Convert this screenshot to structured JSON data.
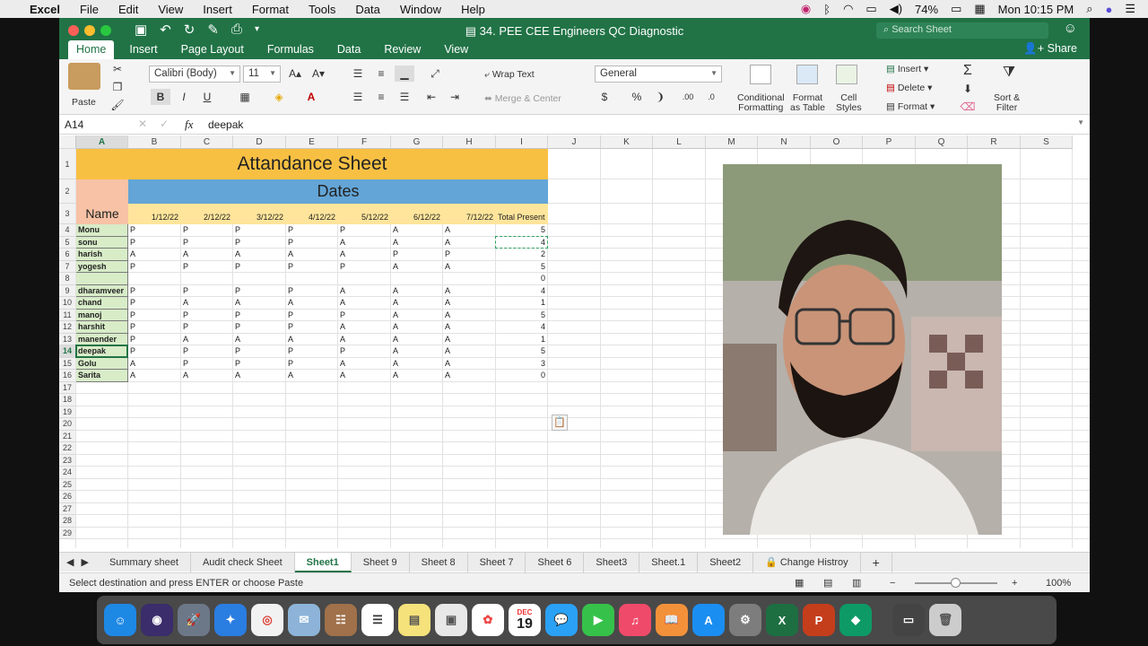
{
  "menubar": {
    "apple": "",
    "app_name": "Excel",
    "items": [
      "File",
      "Edit",
      "View",
      "Insert",
      "Format",
      "Tools",
      "Data",
      "Window",
      "Help"
    ],
    "battery": "74%",
    "clock": "Mon 10:15 PM"
  },
  "window": {
    "title": "34. PEE CEE Engineers QC Diagnostic",
    "search_placeholder": "Search Sheet",
    "share_label": "Share",
    "tabs": [
      "Home",
      "Insert",
      "Page Layout",
      "Formulas",
      "Data",
      "Review",
      "View"
    ],
    "active_tab": "Home"
  },
  "ribbon": {
    "paste": "Paste",
    "font_name": "Calibri (Body)",
    "font_size": "11",
    "bold": "B",
    "italic": "I",
    "underline": "U",
    "wrap_text": "Wrap Text",
    "merge_center": "Merge & Center",
    "number_format": "General",
    "currency": "$",
    "percent": "%",
    "comma": "❩",
    "conditional_formatting": [
      "Conditional",
      "Formatting"
    ],
    "format_as_table": [
      "Format",
      "as Table"
    ],
    "cell_styles": [
      "Cell",
      "Styles"
    ],
    "insert": "Insert",
    "delete": "Delete",
    "format": "Format",
    "sort_filter": [
      "Sort &",
      "Filter"
    ]
  },
  "formula_bar": {
    "cell_ref": "A14",
    "fx": "fx",
    "value": "deepak"
  },
  "grid": {
    "columns": [
      "A",
      "B",
      "C",
      "D",
      "E",
      "F",
      "G",
      "H",
      "I",
      "J",
      "K",
      "L",
      "M",
      "N",
      "O",
      "P",
      "Q",
      "R",
      "S"
    ],
    "rows": [
      "1",
      "2",
      "3",
      "4",
      "5",
      "6",
      "7",
      "8",
      "9",
      "10",
      "11",
      "12",
      "13",
      "14",
      "15",
      "16",
      "17",
      "18",
      "19",
      "20",
      "21",
      "22",
      "23",
      "24",
      "25",
      "26",
      "27",
      "28",
      "29"
    ],
    "title": "Attandance Sheet",
    "dates_header": "Dates",
    "name_header": "Name",
    "date_headers": [
      "1/12/22",
      "2/12/22",
      "3/12/22",
      "4/12/22",
      "5/12/22",
      "6/12/22",
      "7/12/22"
    ],
    "total_header": "Total",
    "present_header": "Present",
    "records": [
      {
        "name": "Monu",
        "marks": [
          "P",
          "P",
          "P",
          "P",
          "P",
          "A",
          "A"
        ],
        "total": "5"
      },
      {
        "name": "sonu",
        "marks": [
          "P",
          "P",
          "P",
          "P",
          "A",
          "A",
          "A"
        ],
        "total": "4"
      },
      {
        "name": "harish",
        "marks": [
          "A",
          "A",
          "A",
          "A",
          "A",
          "P",
          "P"
        ],
        "total": "2"
      },
      {
        "name": "yogesh",
        "marks": [
          "P",
          "P",
          "P",
          "P",
          "P",
          "A",
          "A"
        ],
        "total": "5"
      },
      {
        "name": "",
        "marks": [
          "",
          "",
          "",
          "",
          "",
          "",
          ""
        ],
        "total": "0"
      },
      {
        "name": "dharamveer",
        "marks": [
          "P",
          "P",
          "P",
          "P",
          "A",
          "A",
          "A"
        ],
        "total": "4"
      },
      {
        "name": "chand",
        "marks": [
          "P",
          "A",
          "A",
          "A",
          "A",
          "A",
          "A"
        ],
        "total": "1"
      },
      {
        "name": "manoj",
        "marks": [
          "P",
          "P",
          "P",
          "P",
          "P",
          "A",
          "A"
        ],
        "total": "5"
      },
      {
        "name": "harshit",
        "marks": [
          "P",
          "P",
          "P",
          "P",
          "A",
          "A",
          "A"
        ],
        "total": "4"
      },
      {
        "name": "manender",
        "marks": [
          "P",
          "A",
          "A",
          "A",
          "A",
          "A",
          "A"
        ],
        "total": "1"
      },
      {
        "name": "deepak",
        "marks": [
          "P",
          "P",
          "P",
          "P",
          "P",
          "A",
          "A"
        ],
        "total": "5"
      },
      {
        "name": "Golu",
        "marks": [
          "A",
          "P",
          "P",
          "P",
          "A",
          "A",
          "A"
        ],
        "total": "3"
      },
      {
        "name": "Sarita",
        "marks": [
          "A",
          "A",
          "A",
          "A",
          "A",
          "A",
          "A"
        ],
        "total": "0"
      }
    ]
  },
  "sheet_tabs": [
    "Summary sheet",
    "Audit check Sheet",
    "Sheet1",
    "Sheet 9",
    "Sheet 8",
    "Sheet 7",
    "Sheet 6",
    "Sheet3",
    "Sheet.1",
    "Sheet2",
    "Change Histroy"
  ],
  "active_sheet": "Sheet1",
  "add_sheet": "+",
  "status": {
    "message": "Select destination and press ENTER or choose Paste",
    "zoom": "100%",
    "minus": "−",
    "plus": "+"
  },
  "dock": {
    "calendar_month": "DEC",
    "calendar_day": "19"
  },
  "colors": {
    "excel_green": "#217346",
    "title_fill": "#f8c043",
    "dates_fill": "#63a5d6",
    "name_fill": "#f7c2a5",
    "header_row_fill": "#ffe59b",
    "names_fill": "#d8ecc8"
  }
}
